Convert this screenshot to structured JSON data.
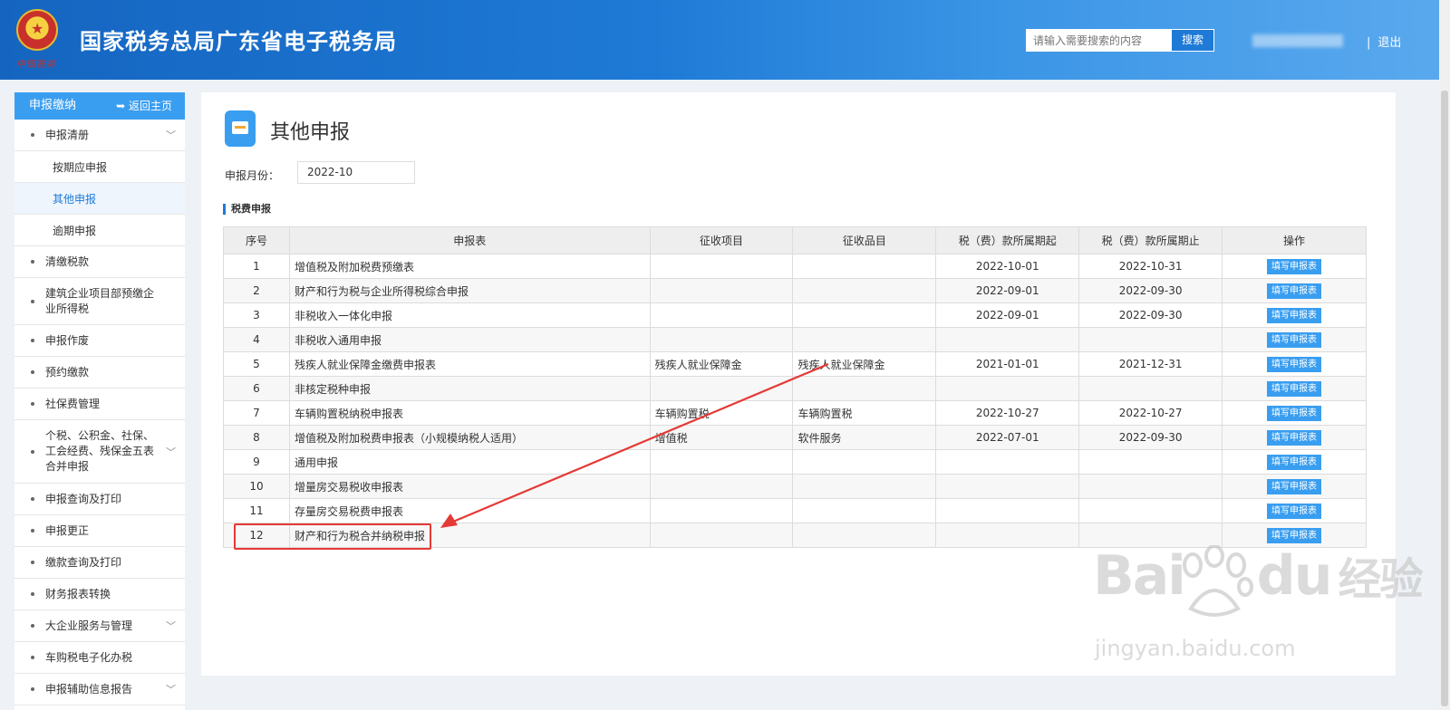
{
  "header": {
    "title": "国家税务总局广东省电子税务局",
    "emblem_caption": "中国税务",
    "search_placeholder": "请输入需要搜索的内容",
    "search_label": "搜索",
    "logout_label": "退出",
    "brand_color": "#1565c0"
  },
  "sidebar": {
    "header": "申报缴纳",
    "back_label": "返回主页",
    "items": [
      {
        "label": "申报清册",
        "expandable": true
      },
      {
        "label": "按期应申报",
        "sub": true
      },
      {
        "label": "其他申报",
        "sub": true,
        "active": true
      },
      {
        "label": "逾期申报",
        "sub": true
      },
      {
        "label": "清缴税款"
      },
      {
        "label": "建筑企业项目部预缴企业所得税"
      },
      {
        "label": "申报作废"
      },
      {
        "label": "预约缴款"
      },
      {
        "label": "社保费管理"
      },
      {
        "label": "个税、公积金、社保、工会经费、残保金五表合并申报",
        "expandable": true
      },
      {
        "label": "申报查询及打印"
      },
      {
        "label": "申报更正"
      },
      {
        "label": "缴款查询及打印"
      },
      {
        "label": "财务报表转换"
      },
      {
        "label": "大企业服务与管理",
        "expandable": true
      },
      {
        "label": "车购税电子化办税"
      },
      {
        "label": "申报辅助信息报告",
        "expandable": true
      }
    ]
  },
  "main": {
    "page_title": "其他申报",
    "month_label": "申报月份：",
    "month_value": "2022-10",
    "section_title": "税费申报",
    "table": {
      "headers": [
        "序号",
        "申报表",
        "征收项目",
        "征收品目",
        "税（费）款所属期起",
        "税（费）款所属期止",
        "操作"
      ],
      "action_label": "填写申报表",
      "rows": [
        [
          "1",
          "增值税及附加税费预缴表",
          "",
          "",
          "2022-10-01",
          "2022-10-31"
        ],
        [
          "2",
          "财产和行为税与企业所得税综合申报",
          "",
          "",
          "2022-09-01",
          "2022-09-30"
        ],
        [
          "3",
          "非税收入一体化申报",
          "",
          "",
          "2022-09-01",
          "2022-09-30"
        ],
        [
          "4",
          "非税收入通用申报",
          "",
          "",
          "",
          ""
        ],
        [
          "5",
          "残疾人就业保障金缴费申报表",
          "残疾人就业保障金",
          "残疾人就业保障金",
          "2021-01-01",
          "2021-12-31"
        ],
        [
          "6",
          "非核定税种申报",
          "",
          "",
          "",
          ""
        ],
        [
          "7",
          "车辆购置税纳税申报表",
          "车辆购置税",
          "车辆购置税",
          "2022-10-27",
          "2022-10-27"
        ],
        [
          "8",
          "增值税及附加税费申报表（小规模纳税人适用）",
          "增值税",
          "软件服务",
          "2022-07-01",
          "2022-09-30"
        ],
        [
          "9",
          "通用申报",
          "",
          "",
          "",
          ""
        ],
        [
          "10",
          "增量房交易税收申报表",
          "",
          "",
          "",
          ""
        ],
        [
          "11",
          "存量房交易税费申报表",
          "",
          "",
          "",
          ""
        ],
        [
          "12",
          "财产和行为税合并纳税申报",
          "",
          "",
          "",
          ""
        ]
      ]
    }
  },
  "watermark": {
    "brand": "Bai",
    "brand_tail": "du",
    "cn": "经验",
    "url": "jingyan.baidu.com"
  },
  "annotation": {
    "highlight_row": 12,
    "color": "#e53935"
  }
}
